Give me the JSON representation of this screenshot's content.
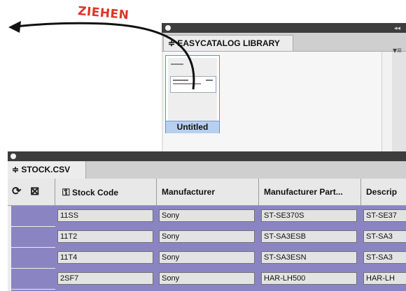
{
  "annotation": {
    "label": "ZIEHEN"
  },
  "library_panel": {
    "tab_label": "≑ EASYCATALOG LIBRARY",
    "menu_icon": "panel-menu-icon",
    "items": [
      {
        "label": "Untitled"
      }
    ]
  },
  "stock_panel": {
    "tab_label": "≑ STOCK.CSV",
    "columns": [
      {
        "label": "Stock Code",
        "icon": "key-icon"
      },
      {
        "label": "Manufacturer"
      },
      {
        "label": "Manufacturer Part..."
      },
      {
        "label": "Descrip"
      }
    ],
    "rows": [
      [
        "11SS",
        "Sony",
        "ST-SE370S",
        "ST-SE37"
      ],
      [
        "11T2",
        "Sony",
        "ST-SA3ESB",
        "ST-SA3"
      ],
      [
        "11T4",
        "Sony",
        "ST-SA3ESN",
        "ST-SA3"
      ],
      [
        "2SF7",
        "Sony",
        "HAR-LH500",
        "HAR-LH"
      ]
    ],
    "colors": {
      "row_header": "#8a85c2",
      "annotation": "#e0332a"
    }
  }
}
